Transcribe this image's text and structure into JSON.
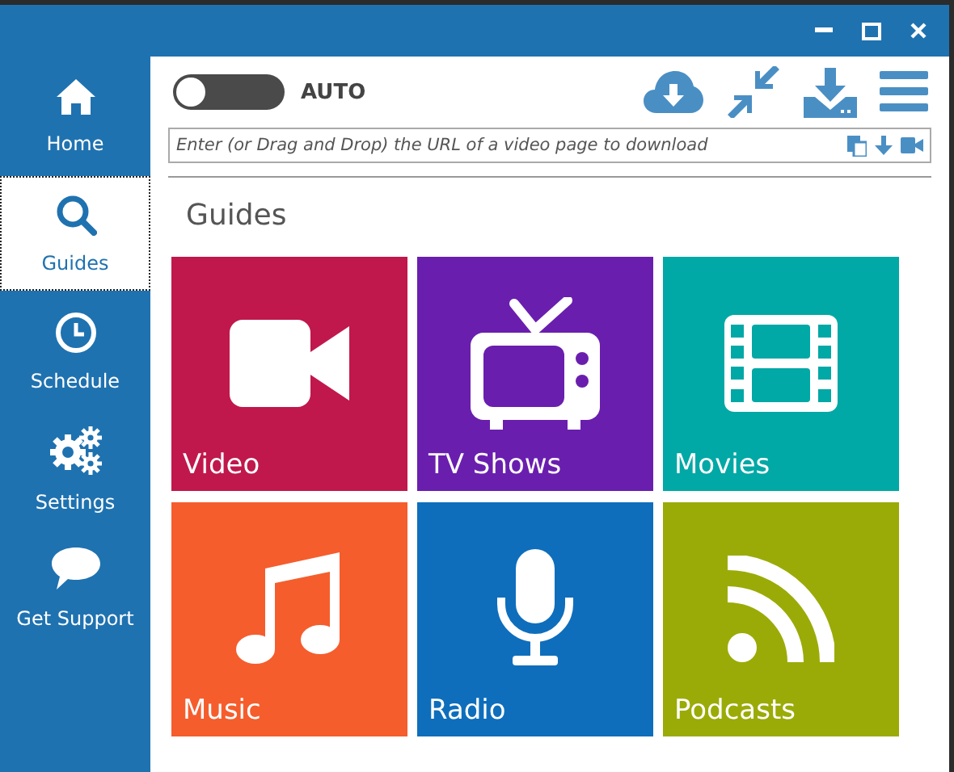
{
  "sidebar": {
    "items": [
      {
        "label": "Home",
        "kind": "home",
        "selected": false
      },
      {
        "label": "Guides",
        "kind": "guides",
        "selected": true
      },
      {
        "label": "Schedule",
        "kind": "schedule",
        "selected": false
      },
      {
        "label": "Settings",
        "kind": "settings",
        "selected": false
      },
      {
        "label": "Get Support",
        "kind": "support",
        "selected": false
      }
    ]
  },
  "toolbar": {
    "auto_toggle": {
      "label": "AUTO",
      "on": false
    }
  },
  "url_field": {
    "placeholder": "Enter (or Drag and Drop) the URL of a video page to download"
  },
  "section_title": "Guides",
  "tiles": [
    {
      "label": "Video",
      "kind": "video",
      "color": "#c0184c"
    },
    {
      "label": "TV Shows",
      "kind": "tv",
      "color": "#6a1eae"
    },
    {
      "label": "Movies",
      "kind": "movies",
      "color": "#00a8a6"
    },
    {
      "label": "Music",
      "kind": "music",
      "color": "#f55d2d"
    },
    {
      "label": "Radio",
      "kind": "radio",
      "color": "#0e6ebc"
    },
    {
      "label": "Podcasts",
      "kind": "podcasts",
      "color": "#9aab07"
    }
  ]
}
